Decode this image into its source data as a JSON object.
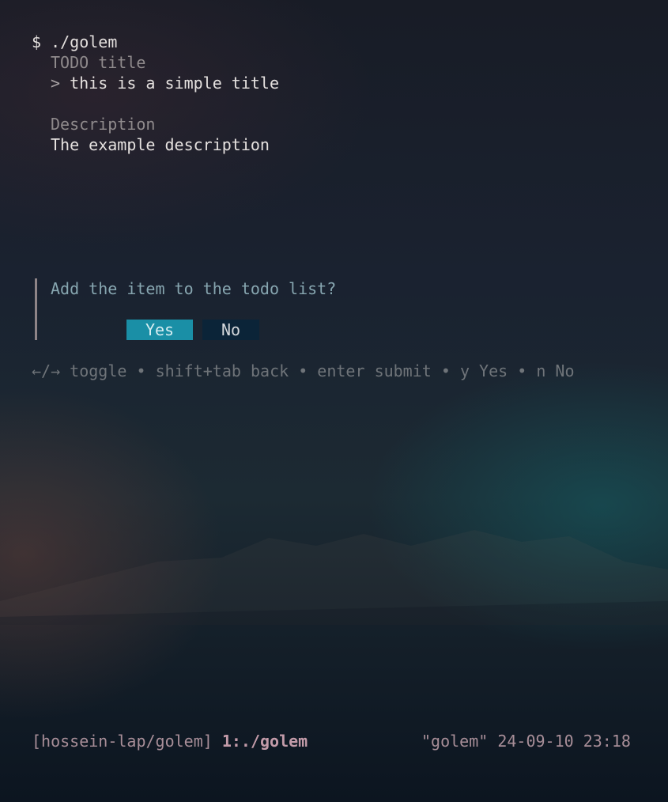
{
  "terminal": {
    "prompt_symbol": "$",
    "command": "./golem",
    "title_label": "TODO title",
    "title_caret": ">",
    "title_value": "this is a simple title",
    "description_label": "Description",
    "description_value": "The example description",
    "confirm_question": "Add the item to the todo list?",
    "yes_label": "Yes",
    "no_label": "No",
    "help": {
      "toggle_key": "←/→",
      "toggle_label": "toggle",
      "back_key": "shift+tab",
      "back_label": "back",
      "submit_key": "enter",
      "submit_label": "submit",
      "yes_key": "y",
      "yes_label": "Yes",
      "no_key": "n",
      "no_label": "No",
      "separator": "•"
    }
  },
  "statusbar": {
    "session": "[hossein-lap/golem]",
    "window": "1:./golem",
    "host": "\"golem\"",
    "datetime": "24-09-10 23:18"
  },
  "colors": {
    "yes_button_bg": "#1a8fa6",
    "no_button_bg": "#0b2438",
    "question_text": "#87a6b0",
    "status_text": "#a88e98"
  }
}
